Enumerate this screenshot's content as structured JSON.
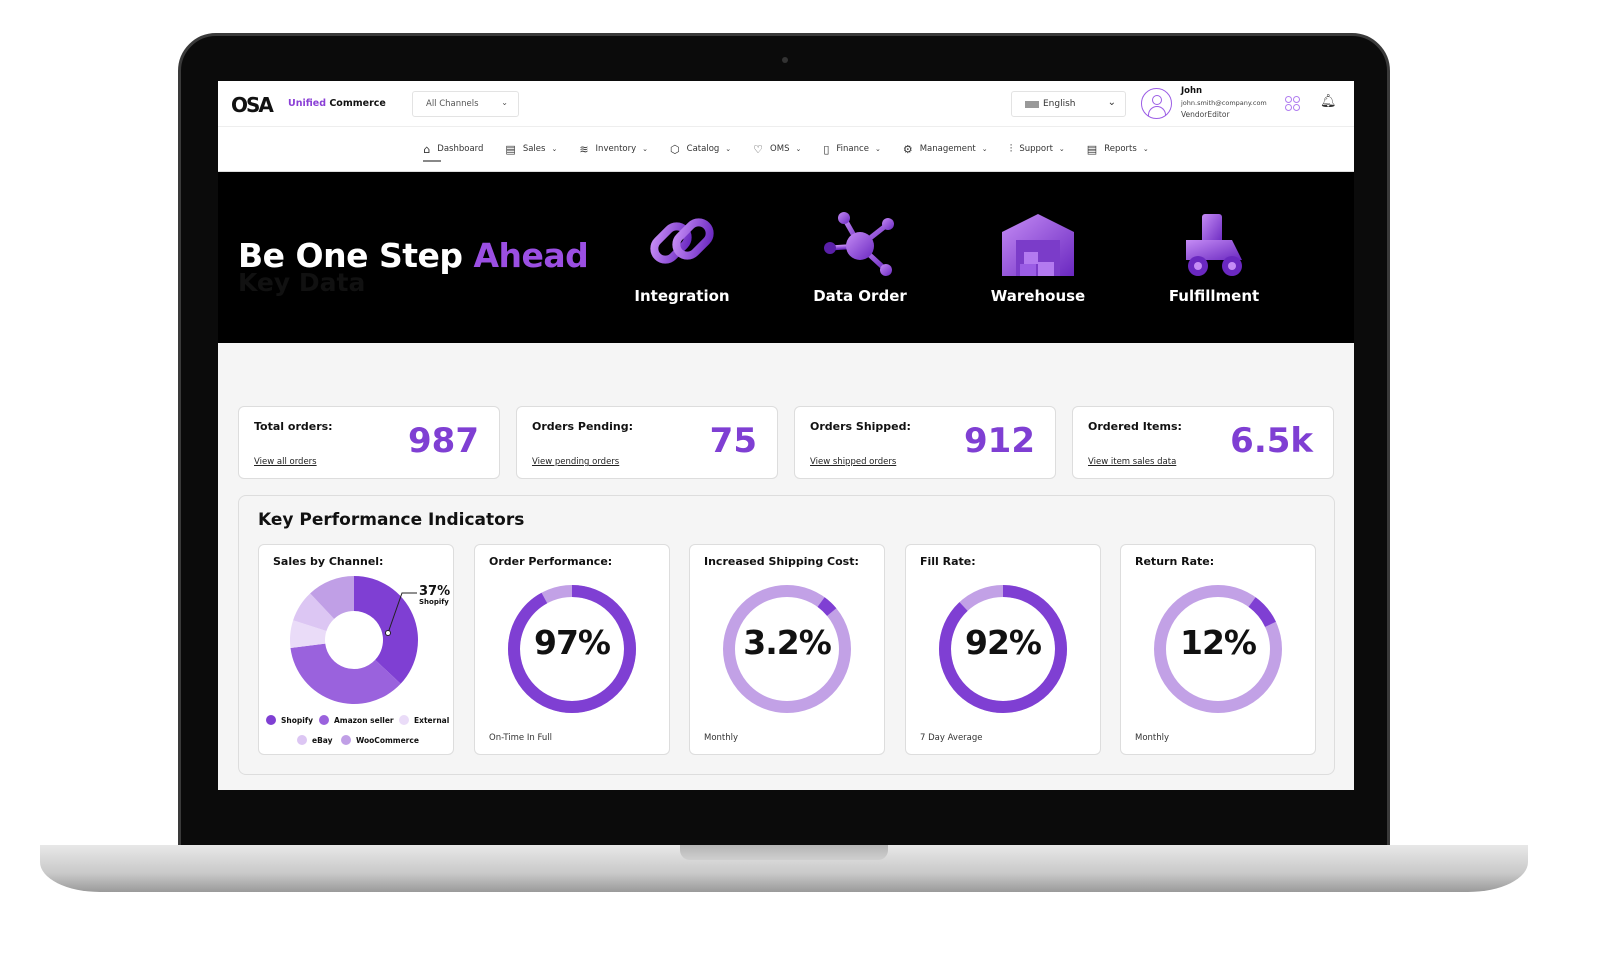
{
  "header": {
    "logo": "OSA",
    "brand_accent": "Unified",
    "brand_rest": " Commerce",
    "channel_select": "All Channels",
    "language": "English",
    "user": {
      "name": "John",
      "email": "john.smith@company.com",
      "role": "VendorEditor"
    }
  },
  "nav": [
    {
      "label": "Dashboard",
      "icon": "home-icon",
      "active": true
    },
    {
      "label": "Sales",
      "icon": "layout-icon"
    },
    {
      "label": "Inventory",
      "icon": "layers-icon"
    },
    {
      "label": "Catalog",
      "icon": "box-icon"
    },
    {
      "label": "OMS",
      "icon": "basket-icon"
    },
    {
      "label": "Finance",
      "icon": "document-icon"
    },
    {
      "label": "Management",
      "icon": "gear-icon"
    },
    {
      "label": "Support",
      "icon": "sliders-icon"
    },
    {
      "label": "Reports",
      "icon": "report-icon"
    }
  ],
  "hero": {
    "title_a": "Be One Step ",
    "title_b": "Ahead",
    "features": [
      "Integration",
      "Data Order",
      "Warehouse",
      "Fulfillment"
    ]
  },
  "key_data": {
    "title": "Key Data",
    "cards": [
      {
        "label": "Total orders:",
        "value": "987",
        "link": "View all orders"
      },
      {
        "label": "Orders Pending:",
        "value": "75",
        "link": "View pending orders"
      },
      {
        "label": "Orders Shipped:",
        "value": "912",
        "link": "View shipped orders"
      },
      {
        "label": "Ordered Items:",
        "value": "6.5k",
        "link": "View item sales data"
      }
    ]
  },
  "kpi": {
    "title": "Key Performance Indicators",
    "sales_by_channel": {
      "title": "Sales by Channel:",
      "callout_value": "37%",
      "callout_label": "Shopify"
    },
    "rings": [
      {
        "title": "Order Performance:",
        "value": "97%",
        "fraction": 0.92,
        "subtitle": "On-Time In Full"
      },
      {
        "title": "Increased Shipping Cost:",
        "value": "3.2%",
        "fraction": 0.04,
        "subtitle": "Monthly"
      },
      {
        "title": "Fill Rate:",
        "value": "92%",
        "fraction": 0.88,
        "subtitle": "7 Day Average"
      },
      {
        "title": "Return Rate:",
        "value": "12%",
        "fraction": 0.08,
        "subtitle": "Monthly"
      }
    ]
  },
  "colors": {
    "accent": "#7f3fd3",
    "light": "#c2a1e6"
  },
  "chart_data": {
    "type": "pie",
    "title": "Sales by Channel:",
    "categories": [
      "Shopify",
      "Amazon seller",
      "External",
      "eBay",
      "WooCommerce"
    ],
    "values": [
      37,
      36,
      7,
      8,
      12
    ],
    "colors": [
      "#7f3fd3",
      "#9a62dd",
      "#eadcf8",
      "#dcc6f3",
      "#c09fe6"
    ],
    "legend": "bottom"
  }
}
